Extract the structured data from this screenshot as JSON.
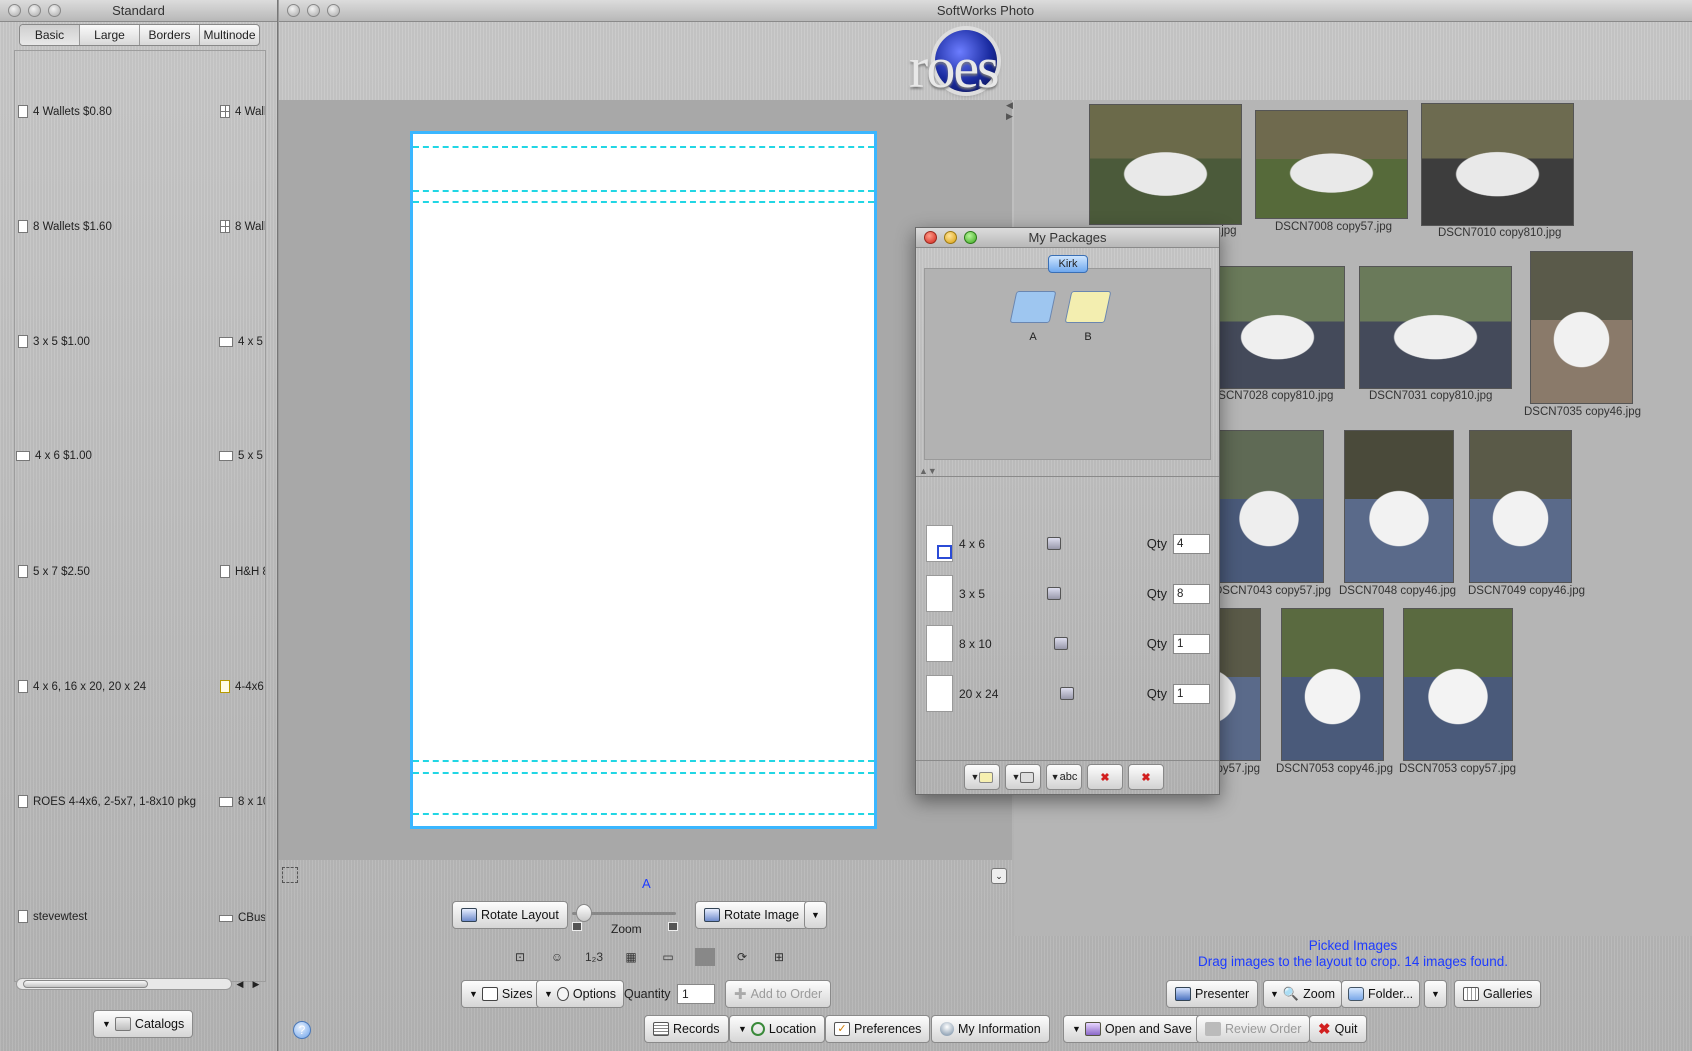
{
  "left_window": {
    "title": "Standard",
    "tabs": [
      {
        "label": "Basic"
      },
      {
        "label": "Large"
      },
      {
        "label": "Borders"
      },
      {
        "label": "Multinode"
      }
    ],
    "items_col1": [
      {
        "label": "4 Wallets $0.80"
      },
      {
        "label": "8 Wallets $1.60"
      },
      {
        "label": "3 x 5 $1.00"
      },
      {
        "label": "4 x 6 $1.00"
      },
      {
        "label": "5 x 7 $2.50"
      },
      {
        "label": "4 x 6, 16 x 20, 20 x 24"
      },
      {
        "label": "ROES 4-4x6, 2-5x7, 1-8x10 pkg"
      },
      {
        "label": "stevewtest"
      }
    ],
    "items_col2": [
      {
        "label": "4 Wall"
      },
      {
        "label": "8 Wall"
      },
      {
        "label": "4 x 5"
      },
      {
        "label": "5 x 5"
      },
      {
        "label": "H&H 8"
      },
      {
        "label": "4-4x6"
      },
      {
        "label": "8 x 10"
      },
      {
        "label": "CBus"
      }
    ],
    "catalogs_label": "Catalogs"
  },
  "main_window": {
    "title": "SoftWorks Photo",
    "logo_text": "roes",
    "page_label": "A",
    "rotate_layout_label": "Rotate Layout",
    "rotate_image_label": "Rotate Image",
    "zoom_label": "Zoom",
    "zoom_level": 0.05,
    "sizes_label": "Sizes",
    "options_label": "Options",
    "quantity_label": "Quantity",
    "quantity_value": "1",
    "add_to_order_label": "Add to Order",
    "records_label": "Records",
    "location_label": "Location",
    "preferences_label": "Preferences",
    "my_information_label": "My Information",
    "open_and_save_label": "Open and Save",
    "review_order_label": "Review Order",
    "quit_label": "Quit",
    "help_icon_label": "?"
  },
  "browser": {
    "status_line1": "Picked Images",
    "status_line2": "Drag images to the layout to crop. 14 images found.",
    "presenter_label": "Presenter",
    "zoom_label": "Zoom",
    "folder_label": "Folder...",
    "galleries_label": "Galleries",
    "images": [
      {
        "caption": ".jpg",
        "colors": [
          "#6b6a4a",
          "#e9e9e9",
          "#4b5a3a"
        ]
      },
      {
        "caption": "DSCN7008 copy57.jpg",
        "colors": [
          "#6f6a4e",
          "#e9e9e9",
          "#566a3a"
        ]
      },
      {
        "caption": "DSCN7010 copy810.jpg",
        "colors": [
          "#6d6b50",
          "#e9e9e9",
          "#3d3d3d"
        ]
      },
      {
        "caption": "DSCN7028 copy810.jpg",
        "colors": [
          "#6a7a5a",
          "#efefef",
          "#444a5a"
        ]
      },
      {
        "caption": "DSCN7031 copy810.jpg",
        "colors": [
          "#6a7a5a",
          "#efefef",
          "#444a5a"
        ]
      },
      {
        "caption": "DSCN7035 copy46.jpg",
        "colors": [
          "#5a5a4a",
          "#f1f1f1",
          "#8a7a6a"
        ]
      },
      {
        "caption": "DSCN7043 copy57.jpg",
        "colors": [
          "#5f6a55",
          "#eeeeee",
          "#4a5a7a"
        ]
      },
      {
        "caption": "DSCN7048 copy46.jpg",
        "colors": [
          "#4a4a3a",
          "#f2f2f2",
          "#5a6a8a"
        ]
      },
      {
        "caption": "DSCN7049 copy46.jpg",
        "colors": [
          "#5a5a48",
          "#f2f2f2",
          "#5a6a8a"
        ]
      },
      {
        "caption": "DSCN7050 copy57.jpg",
        "colors": [
          "#5a5a48",
          "#f0f0f0",
          "#5a6a8a"
        ]
      },
      {
        "caption": "DSCN7053 copy46.jpg",
        "colors": [
          "#5a6a40",
          "#f3f3f3",
          "#4a5a7a"
        ]
      },
      {
        "caption": "DSCN7053 copy57.jpg",
        "colors": [
          "#5a6a40",
          "#f3f3f3",
          "#4a5a7a"
        ]
      }
    ]
  },
  "packages_dialog": {
    "title": "My Packages",
    "tab_label": "Kirk",
    "packages": [
      {
        "label": "A",
        "color": "#9ec6f0"
      },
      {
        "label": "B",
        "color": "#f3eeb0"
      }
    ],
    "sizes": [
      {
        "name": "4 x 6",
        "qty_label": "Qty",
        "qty": "4"
      },
      {
        "name": "3 x 5",
        "qty_label": "Qty",
        "qty": "8"
      },
      {
        "name": "8 x 10",
        "qty_label": "Qty",
        "qty": "1"
      },
      {
        "name": "20 x 24",
        "qty_label": "Qty",
        "qty": "1"
      }
    ],
    "toolbar_rename_label": "abc"
  },
  "colors": {
    "accent_blue": "#1d3bff",
    "layout_border": "#3ab6ff",
    "crop_guide": "#21d6e4"
  }
}
